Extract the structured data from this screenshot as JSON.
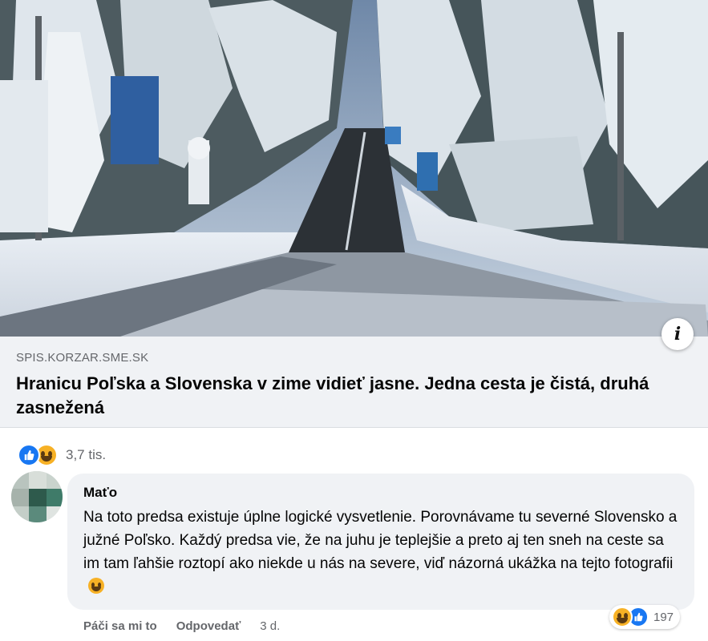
{
  "link_card": {
    "source": "SPIS.KORZAR.SME.SK",
    "title": "Hranicu Poľska a Slovenska v zime vidieť jasne. Jedna cesta je čistá, druhá zasnežená",
    "info_icon": "info-icon"
  },
  "post_reactions": {
    "icons": [
      "like-icon",
      "haha-icon"
    ],
    "count": "3,7 tis."
  },
  "comment": {
    "author": "Maťo",
    "text": "Na toto predsa existuje úplne logické vysvetlenie. Porovnávame tu severné Slovensko a južné Poľsko. Každý predsa vie, že na juhu je teplejšie a preto aj ten sneh na ceste sa im tam ľahšie roztopí ako niekde u nás na severe, viď názorná ukážka na tejto fotografii",
    "trailing_emoji": "grinning-sweat-emoji",
    "reaction_icons": [
      "haha-icon",
      "like-icon"
    ],
    "reaction_count": "197",
    "actions": {
      "like": "Páči sa mi to",
      "reply": "Odpovedať",
      "time": "3 d."
    }
  },
  "colors": {
    "facebook_blue": "#1877f2",
    "haha_yellow": "#f7b125",
    "card_gray": "#f0f2f5",
    "secondary_text": "#65676b"
  }
}
